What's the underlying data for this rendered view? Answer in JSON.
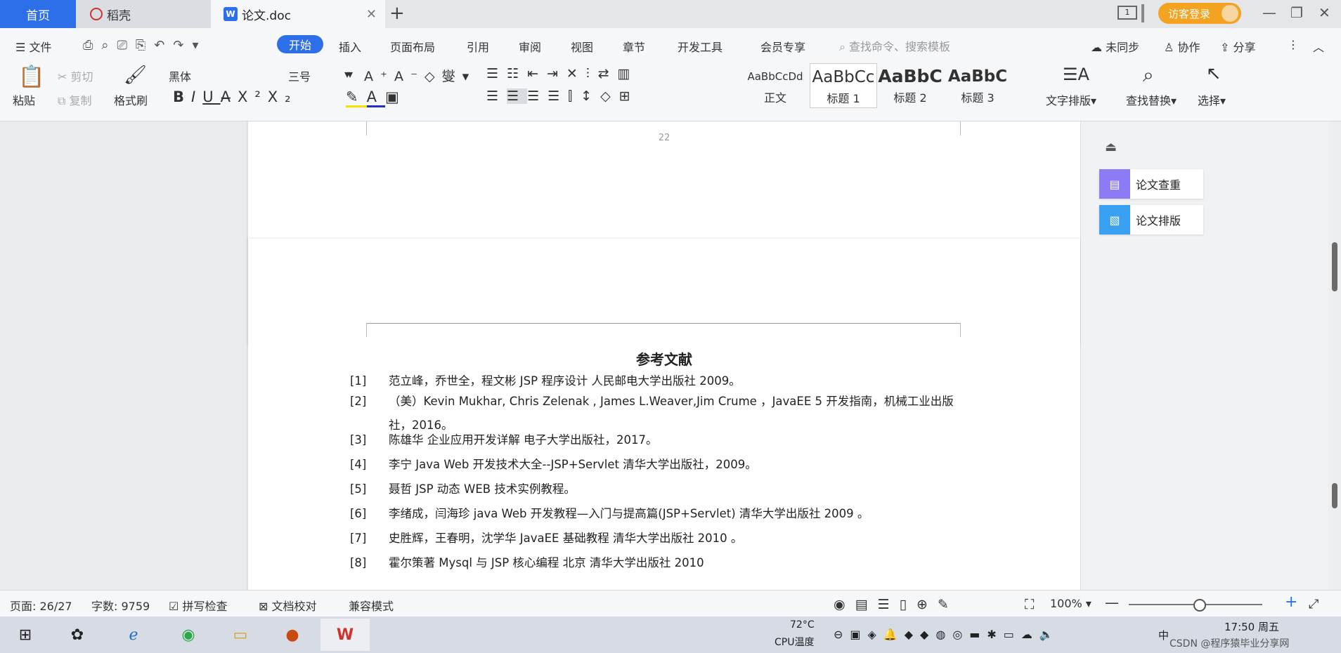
{
  "tabs": {
    "home": "首页",
    "docer": "稻壳",
    "document": "论文.doc",
    "visitor": "访客登录"
  },
  "menu": {
    "file": "文件",
    "items": [
      "开始",
      "插入",
      "页面布局",
      "引用",
      "审阅",
      "视图",
      "章节",
      "开发工具",
      "会员专享"
    ],
    "search_placeholder": "查找命令、搜索模板",
    "sync": "未同步",
    "collab": "协作",
    "share": "分享"
  },
  "ribbon": {
    "paste": "粘贴",
    "cut": "剪切",
    "copy": "复制",
    "format_painter": "格式刷",
    "font_name": "黑体",
    "font_size": "三号",
    "styles": [
      {
        "preview": "AaBbCcDd",
        "name": "正文"
      },
      {
        "preview": "AaBbCc",
        "name": "标题 1"
      },
      {
        "preview": "AaBbC",
        "name": "标题 2"
      },
      {
        "preview": "AaBbC",
        "name": "标题 3"
      }
    ],
    "text_layout": "文字排版",
    "find_replace": "查找替换",
    "select": "选择"
  },
  "document": {
    "page_number": "22",
    "heading": "参考文献",
    "references": [
      {
        "num": "[1]",
        "text": "范立峰，乔世全，程文彬 JSP 程序设计 人民邮电大学出版社 2009。"
      },
      {
        "num": "[2]",
        "text": "（美）Kevin Mukhar, Chris Zelenak , James L.Weaver,Jim Crume ，JavaEE 5 开发指南，机械工业出版社，2016。"
      },
      {
        "num": "[3]",
        "text": "陈雄华 企业应用开发详解 电子大学出版社，2017。"
      },
      {
        "num": "[4]",
        "text": "李宁 Java Web 开发技术大全--JSP+Servlet 清华大学出版社，2009。"
      },
      {
        "num": "[5]",
        "text": "聂哲 JSP 动态 WEB 技术实例教程。"
      },
      {
        "num": "[6]",
        "text": "李绪成，闫海珍 java Web 开发教程—入门与提高篇(JSP+Servlet) 清华大学出版社 2009 。"
      },
      {
        "num": "[7]",
        "text": "史胜辉，王春明，沈学华 JavaEE 基础教程 清华大学出版社 2010 。"
      },
      {
        "num": "[8]",
        "text": "霍尔策著 Mysql 与 JSP 核心编程 北京 清华大学出版社 2010"
      }
    ]
  },
  "side_panel": {
    "check": "论文查重",
    "layout": "论文排版"
  },
  "status": {
    "page": "页面: 26/27",
    "words": "字数: 9759",
    "spell": "拼写检查",
    "proof": "文档校对",
    "compat": "兼容模式",
    "zoom": "100%"
  },
  "taskbar": {
    "temp": "72°C",
    "cpu": "CPU温度",
    "ime": "中",
    "time": "17:50 周五",
    "watermark": "CSDN @程序猿毕业分享网"
  },
  "colors": {
    "accent": "#2d6fe8",
    "visitor": "#f3a320"
  }
}
